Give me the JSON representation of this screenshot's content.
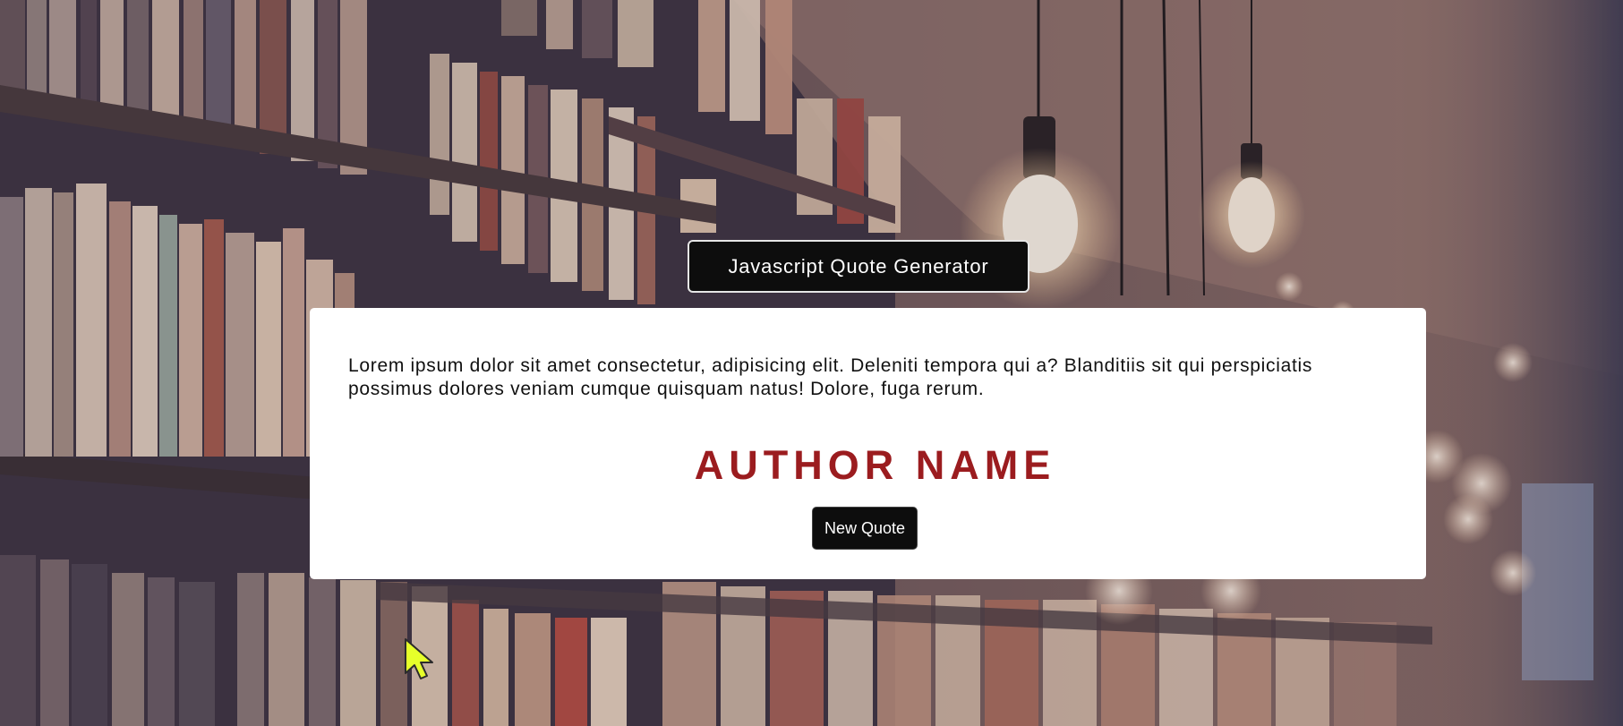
{
  "header": {
    "title": "Javascript Quote Generator"
  },
  "quote": {
    "text": "Lorem ipsum dolor sit amet consectetur, adipisicing elit. Deleniti tempora qui a? Blanditiis sit qui perspiciatis possimus dolores veniam cumque quisquam natus! Dolore, fuga rerum.",
    "author": "AUTHOR NAME"
  },
  "actions": {
    "new_quote_label": "New Quote"
  },
  "colors": {
    "author": "#9b1c1f",
    "badge_bg": "#0d0d0d",
    "card_bg": "#ffffff"
  },
  "icons": {
    "cursor": "mouse-pointer-icon"
  }
}
